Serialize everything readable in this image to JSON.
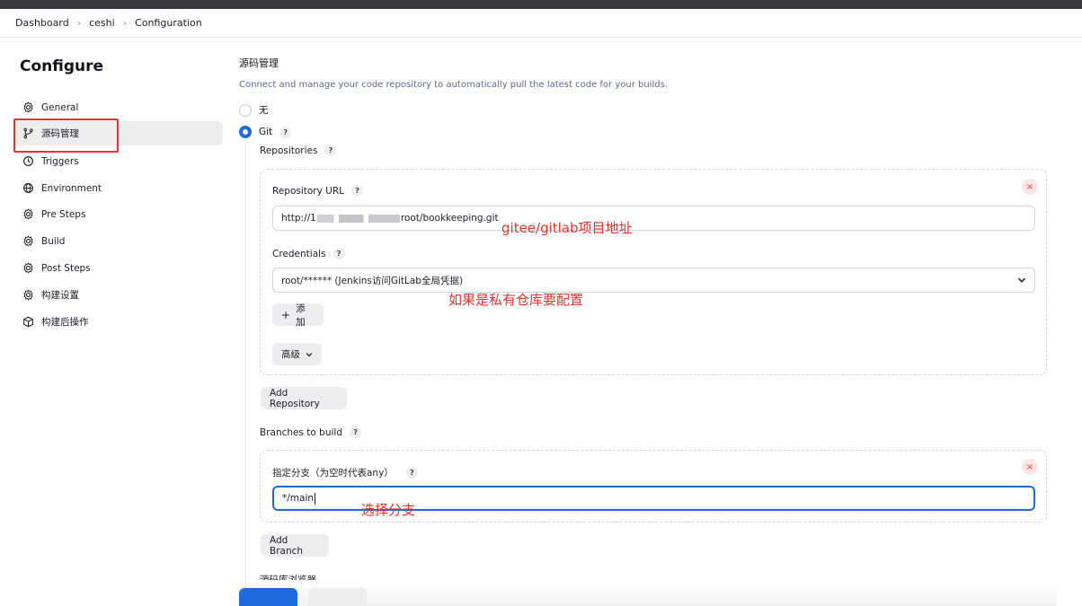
{
  "breadcrumb": [
    "Dashboard",
    "ceshi",
    "Configuration"
  ],
  "sidebar": {
    "title": "Configure",
    "items": [
      {
        "label": "General",
        "icon": "gear-icon"
      },
      {
        "label": "源码管理",
        "icon": "branch-icon"
      },
      {
        "label": "Triggers",
        "icon": "clock-icon"
      },
      {
        "label": "Environment",
        "icon": "globe-icon"
      },
      {
        "label": "Pre Steps",
        "icon": "gear-icon"
      },
      {
        "label": "Build",
        "icon": "gear-icon"
      },
      {
        "label": "Post Steps",
        "icon": "gear-icon"
      },
      {
        "label": "构建设置",
        "icon": "gear-icon"
      },
      {
        "label": "构建后操作",
        "icon": "box-icon"
      }
    ]
  },
  "main": {
    "section_title": "源码管理",
    "section_desc": "Connect and manage your code repository to automatically pull the latest code for your builds.",
    "options": {
      "none": "无",
      "git": "Git"
    },
    "repositories_label": "Repositories",
    "repo_url_label": "Repository URL",
    "repo_url_prefix": "http://1",
    "repo_url_suffix": "root/bookkeeping.git",
    "credentials_label": "Credentials",
    "credentials_value": "root/****** (Jenkins访问GitLab全局凭据)",
    "add_label": "添加",
    "advanced_label": "高级",
    "add_repository": "Add Repository",
    "branches_label": "Branches to build",
    "branch_spec_label": "指定分支（为空时代表any）",
    "branch_value": "*/main",
    "add_branch": "Add Branch",
    "cut_label": "源码库浏览器",
    "help": "?",
    "close": "×"
  },
  "annotations": {
    "repo": "gitee/gitlab项目地址",
    "cred": "如果是私有仓库要配置",
    "branch": "选择分支"
  },
  "colors": {
    "accent": "#1f6bde",
    "annotation": "#e8322c"
  }
}
